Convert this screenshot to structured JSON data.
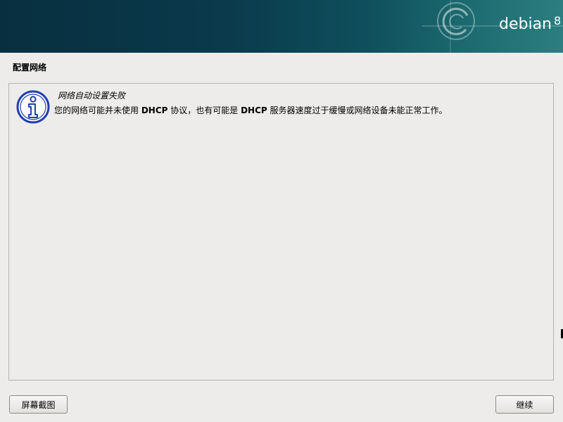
{
  "banner": {
    "brand": "debian",
    "version": "8"
  },
  "page": {
    "title": "配置网络"
  },
  "message": {
    "icon": "info-icon",
    "title": "网络自动设置失败",
    "body_part1": "您的网络可能并未使用 ",
    "body_bold1": "DHCP",
    "body_part2": " 协议，也有可能是 ",
    "body_bold2": "DHCP",
    "body_part3": " 服务器速度过于缓慢或网络设备未能正常工作。"
  },
  "buttons": {
    "screenshot": "屏幕截图",
    "continue": "继续"
  },
  "colors": {
    "banner_dark": "#082f3f",
    "banner_light": "#2c7e80",
    "background": "#edeceb",
    "icon_blue": "#1f3fb0"
  }
}
